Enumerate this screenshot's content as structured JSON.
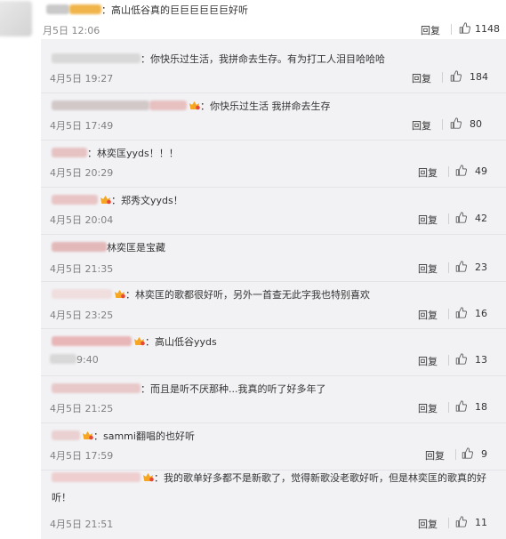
{
  "top_comment": {
    "text": "：高山低谷真的巨巨巨巨巨巨好听",
    "time": "月5日 12:06",
    "reply_label": "回复",
    "likes": "1148"
  },
  "replies": [
    {
      "text": "：你快乐过生活，我拼命去生存。有为打工人泪目哈哈哈",
      "time": "4月5日 19:27",
      "reply_label": "回复",
      "likes": "184"
    },
    {
      "text": "：你快乐过生活 我拼命去生存",
      "time": "4月5日 17:49",
      "reply_label": "回复",
      "likes": "80"
    },
    {
      "text": "：林奕匡yyds！！！",
      "time": "4月5日 20:29",
      "reply_label": "回复",
      "likes": "49"
    },
    {
      "text": "：郑秀文yyds！",
      "time": "4月5日 20:04",
      "reply_label": "回复",
      "likes": "42"
    },
    {
      "text": "林奕匡是宝藏",
      "time": "4月5日 21:35",
      "reply_label": "回复",
      "likes": "23"
    },
    {
      "text": "：林奕匡的歌都很好听，另外一首查无此字我也特别喜欢",
      "time": "4月5日 23:25",
      "reply_label": "回复",
      "likes": "16"
    },
    {
      "text": "：高山低谷yyds",
      "time": "9:40",
      "reply_label": "回复",
      "likes": "13"
    },
    {
      "text": "：而且是听不厌那种...我真的听了好多年了",
      "time": "4月5日 21:25",
      "reply_label": "回复",
      "likes": "18"
    },
    {
      "text": "：sammi翻唱的也好听",
      "time": "4月5日 17:59",
      "reply_label": "回复",
      "likes": "9"
    },
    {
      "text": "：我的歌单好多都不是新歌了，觉得新歌没老歌好听，但是林奕匡的歌真的好听！",
      "time": "4月5日 21:51",
      "reply_label": "回复",
      "likes": "11"
    }
  ],
  "colors": {
    "reply_bg": "#f2f2f5",
    "time": "#808080",
    "vip_badge": "#f5a623"
  },
  "icons": [
    "thumbs-up-icon",
    "vip-badge-icon"
  ]
}
